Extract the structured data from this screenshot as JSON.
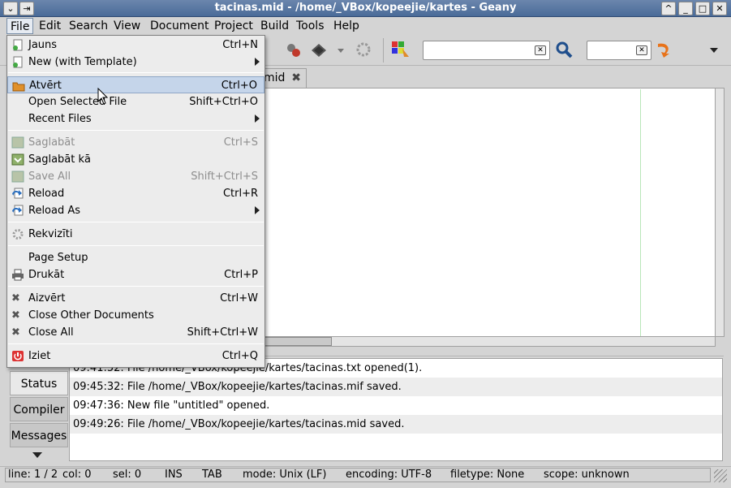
{
  "window": {
    "title": "tacinas.mid - /home/_VBox/kopeejie/kartes - Geany",
    "buttons": {
      "help": "^",
      "minimize": "_",
      "maximize": "□",
      "close": "✕"
    }
  },
  "menubar": [
    "File",
    "Edit",
    "Search",
    "View",
    "Document",
    "Project",
    "Build",
    "Tools",
    "Help"
  ],
  "editor": {
    "tab_label": "mid"
  },
  "file_menu": {
    "items": [
      {
        "label": "Jauns",
        "accel": "Ctrl+N",
        "icon": "new-file-icon",
        "enabled": true
      },
      {
        "label": "New (with Template)",
        "accel": "",
        "submenu": true,
        "icon": "new-template-icon",
        "enabled": true
      },
      {
        "label": "Atvērt",
        "accel": "Ctrl+O",
        "icon": "open-folder-icon",
        "enabled": true,
        "highlighted": true
      },
      {
        "label": "Open Selected File",
        "accel": "Shift+Ctrl+O",
        "enabled": true
      },
      {
        "label": "Recent Files",
        "accel": "",
        "submenu": true,
        "enabled": true
      },
      {
        "label": "Saglabāt",
        "accel": "Ctrl+S",
        "icon": "save-icon",
        "enabled": false
      },
      {
        "label": "Saglabāt kā",
        "accel": "",
        "icon": "save-as-icon",
        "enabled": true
      },
      {
        "label": "Save All",
        "accel": "Shift+Ctrl+S",
        "icon": "save-all-icon",
        "enabled": false
      },
      {
        "label": "Reload",
        "accel": "Ctrl+R",
        "icon": "reload-icon",
        "enabled": true
      },
      {
        "label": "Reload As",
        "accel": "",
        "submenu": true,
        "icon": "reload-as-icon",
        "enabled": true
      },
      {
        "label": "Rekvizīti",
        "accel": "",
        "icon": "properties-icon",
        "enabled": true
      },
      {
        "label": "Page Setup",
        "accel": "",
        "enabled": true
      },
      {
        "label": "Drukāt",
        "accel": "Ctrl+P",
        "icon": "print-icon",
        "enabled": true
      },
      {
        "label": "Aizvērt",
        "accel": "Ctrl+W",
        "icon": "close-doc-icon",
        "enabled": true
      },
      {
        "label": "Close Other Documents",
        "accel": "",
        "icon": "close-others-icon",
        "enabled": true
      },
      {
        "label": "Close All",
        "accel": "Shift+Ctrl+W",
        "icon": "close-all-icon",
        "enabled": true
      },
      {
        "label": "Iziet",
        "accel": "Ctrl+Q",
        "icon": "quit-icon",
        "enabled": true
      }
    ]
  },
  "messages": {
    "tabs": [
      "Status",
      "Compiler",
      "Messages"
    ],
    "rows": [
      "09:41:52: File /home/_VBox/kopeejie/kartes/tacinas.txt opened(1).",
      "09:45:32: File /home/_VBox/kopeejie/kartes/tacinas.mif saved.",
      "09:47:36: New file \"untitled\" opened.",
      "09:49:26: File /home/_VBox/kopeejie/kartes/tacinas.mid saved."
    ]
  },
  "statusbar": {
    "line": "line: 1 / 2",
    "col": "col: 0",
    "sel": "sel: 0",
    "ins": "INS",
    "tab": "TAB",
    "mode": "mode: Unix (LF)",
    "encoding": "encoding: UTF-8",
    "filetype": "filetype: None",
    "scope": "scope: unknown"
  }
}
